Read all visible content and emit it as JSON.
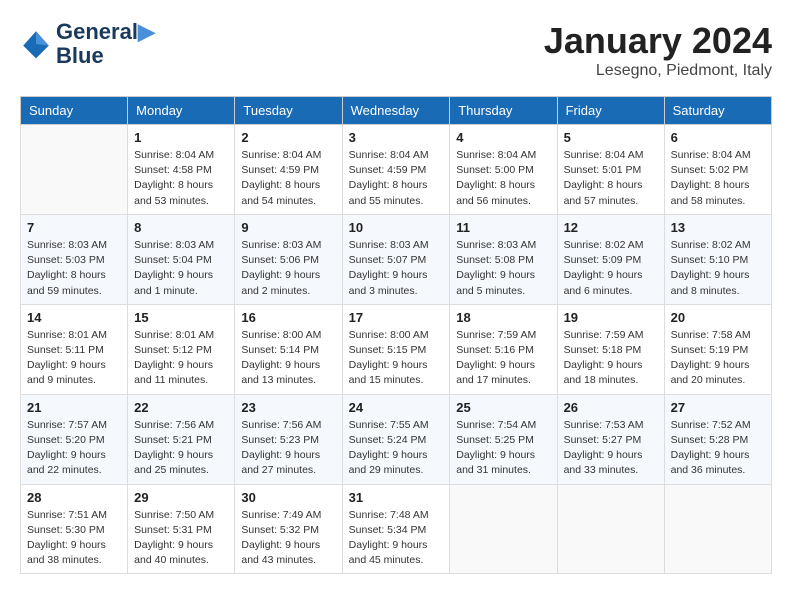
{
  "logo": {
    "line1": "General",
    "line2": "Blue"
  },
  "title": "January 2024",
  "location": "Lesegno, Piedmont, Italy",
  "weekdays": [
    "Sunday",
    "Monday",
    "Tuesday",
    "Wednesday",
    "Thursday",
    "Friday",
    "Saturday"
  ],
  "weeks": [
    [
      {
        "day": "",
        "info": ""
      },
      {
        "day": "1",
        "info": "Sunrise: 8:04 AM\nSunset: 4:58 PM\nDaylight: 8 hours\nand 53 minutes."
      },
      {
        "day": "2",
        "info": "Sunrise: 8:04 AM\nSunset: 4:59 PM\nDaylight: 8 hours\nand 54 minutes."
      },
      {
        "day": "3",
        "info": "Sunrise: 8:04 AM\nSunset: 4:59 PM\nDaylight: 8 hours\nand 55 minutes."
      },
      {
        "day": "4",
        "info": "Sunrise: 8:04 AM\nSunset: 5:00 PM\nDaylight: 8 hours\nand 56 minutes."
      },
      {
        "day": "5",
        "info": "Sunrise: 8:04 AM\nSunset: 5:01 PM\nDaylight: 8 hours\nand 57 minutes."
      },
      {
        "day": "6",
        "info": "Sunrise: 8:04 AM\nSunset: 5:02 PM\nDaylight: 8 hours\nand 58 minutes."
      }
    ],
    [
      {
        "day": "7",
        "info": "Sunrise: 8:03 AM\nSunset: 5:03 PM\nDaylight: 8 hours\nand 59 minutes."
      },
      {
        "day": "8",
        "info": "Sunrise: 8:03 AM\nSunset: 5:04 PM\nDaylight: 9 hours\nand 1 minute."
      },
      {
        "day": "9",
        "info": "Sunrise: 8:03 AM\nSunset: 5:06 PM\nDaylight: 9 hours\nand 2 minutes."
      },
      {
        "day": "10",
        "info": "Sunrise: 8:03 AM\nSunset: 5:07 PM\nDaylight: 9 hours\nand 3 minutes."
      },
      {
        "day": "11",
        "info": "Sunrise: 8:03 AM\nSunset: 5:08 PM\nDaylight: 9 hours\nand 5 minutes."
      },
      {
        "day": "12",
        "info": "Sunrise: 8:02 AM\nSunset: 5:09 PM\nDaylight: 9 hours\nand 6 minutes."
      },
      {
        "day": "13",
        "info": "Sunrise: 8:02 AM\nSunset: 5:10 PM\nDaylight: 9 hours\nand 8 minutes."
      }
    ],
    [
      {
        "day": "14",
        "info": "Sunrise: 8:01 AM\nSunset: 5:11 PM\nDaylight: 9 hours\nand 9 minutes."
      },
      {
        "day": "15",
        "info": "Sunrise: 8:01 AM\nSunset: 5:12 PM\nDaylight: 9 hours\nand 11 minutes."
      },
      {
        "day": "16",
        "info": "Sunrise: 8:00 AM\nSunset: 5:14 PM\nDaylight: 9 hours\nand 13 minutes."
      },
      {
        "day": "17",
        "info": "Sunrise: 8:00 AM\nSunset: 5:15 PM\nDaylight: 9 hours\nand 15 minutes."
      },
      {
        "day": "18",
        "info": "Sunrise: 7:59 AM\nSunset: 5:16 PM\nDaylight: 9 hours\nand 17 minutes."
      },
      {
        "day": "19",
        "info": "Sunrise: 7:59 AM\nSunset: 5:18 PM\nDaylight: 9 hours\nand 18 minutes."
      },
      {
        "day": "20",
        "info": "Sunrise: 7:58 AM\nSunset: 5:19 PM\nDaylight: 9 hours\nand 20 minutes."
      }
    ],
    [
      {
        "day": "21",
        "info": "Sunrise: 7:57 AM\nSunset: 5:20 PM\nDaylight: 9 hours\nand 22 minutes."
      },
      {
        "day": "22",
        "info": "Sunrise: 7:56 AM\nSunset: 5:21 PM\nDaylight: 9 hours\nand 25 minutes."
      },
      {
        "day": "23",
        "info": "Sunrise: 7:56 AM\nSunset: 5:23 PM\nDaylight: 9 hours\nand 27 minutes."
      },
      {
        "day": "24",
        "info": "Sunrise: 7:55 AM\nSunset: 5:24 PM\nDaylight: 9 hours\nand 29 minutes."
      },
      {
        "day": "25",
        "info": "Sunrise: 7:54 AM\nSunset: 5:25 PM\nDaylight: 9 hours\nand 31 minutes."
      },
      {
        "day": "26",
        "info": "Sunrise: 7:53 AM\nSunset: 5:27 PM\nDaylight: 9 hours\nand 33 minutes."
      },
      {
        "day": "27",
        "info": "Sunrise: 7:52 AM\nSunset: 5:28 PM\nDaylight: 9 hours\nand 36 minutes."
      }
    ],
    [
      {
        "day": "28",
        "info": "Sunrise: 7:51 AM\nSunset: 5:30 PM\nDaylight: 9 hours\nand 38 minutes."
      },
      {
        "day": "29",
        "info": "Sunrise: 7:50 AM\nSunset: 5:31 PM\nDaylight: 9 hours\nand 40 minutes."
      },
      {
        "day": "30",
        "info": "Sunrise: 7:49 AM\nSunset: 5:32 PM\nDaylight: 9 hours\nand 43 minutes."
      },
      {
        "day": "31",
        "info": "Sunrise: 7:48 AM\nSunset: 5:34 PM\nDaylight: 9 hours\nand 45 minutes."
      },
      {
        "day": "",
        "info": ""
      },
      {
        "day": "",
        "info": ""
      },
      {
        "day": "",
        "info": ""
      }
    ]
  ]
}
